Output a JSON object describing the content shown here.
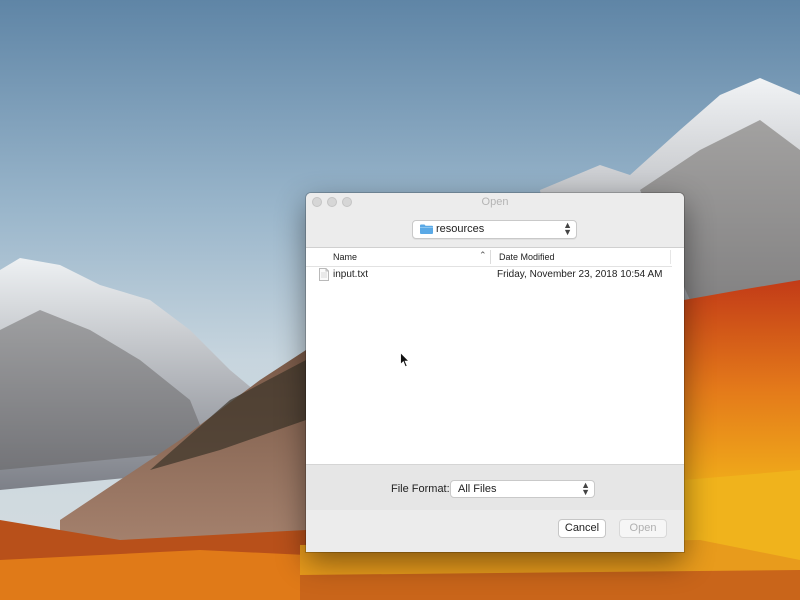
{
  "dialog": {
    "title": "Open",
    "location": {
      "folder_icon": "folder-icon",
      "label": "resources"
    },
    "browser": {
      "columns": {
        "name": "Name",
        "date_modified": "Date Modified"
      },
      "files": [
        {
          "icon": "text-file-icon",
          "name": "input.txt",
          "date_modified": "Friday, November 23, 2018 10:54 AM"
        }
      ]
    },
    "accessory": {
      "format_label": "File Format:",
      "format_value": "All Files"
    },
    "buttons": {
      "cancel": "Cancel",
      "open": "Open"
    }
  },
  "colors": {
    "folder": "#5aa9e6",
    "dialog_bg": "#ececec",
    "disabled_text": "#b0b0b0"
  }
}
